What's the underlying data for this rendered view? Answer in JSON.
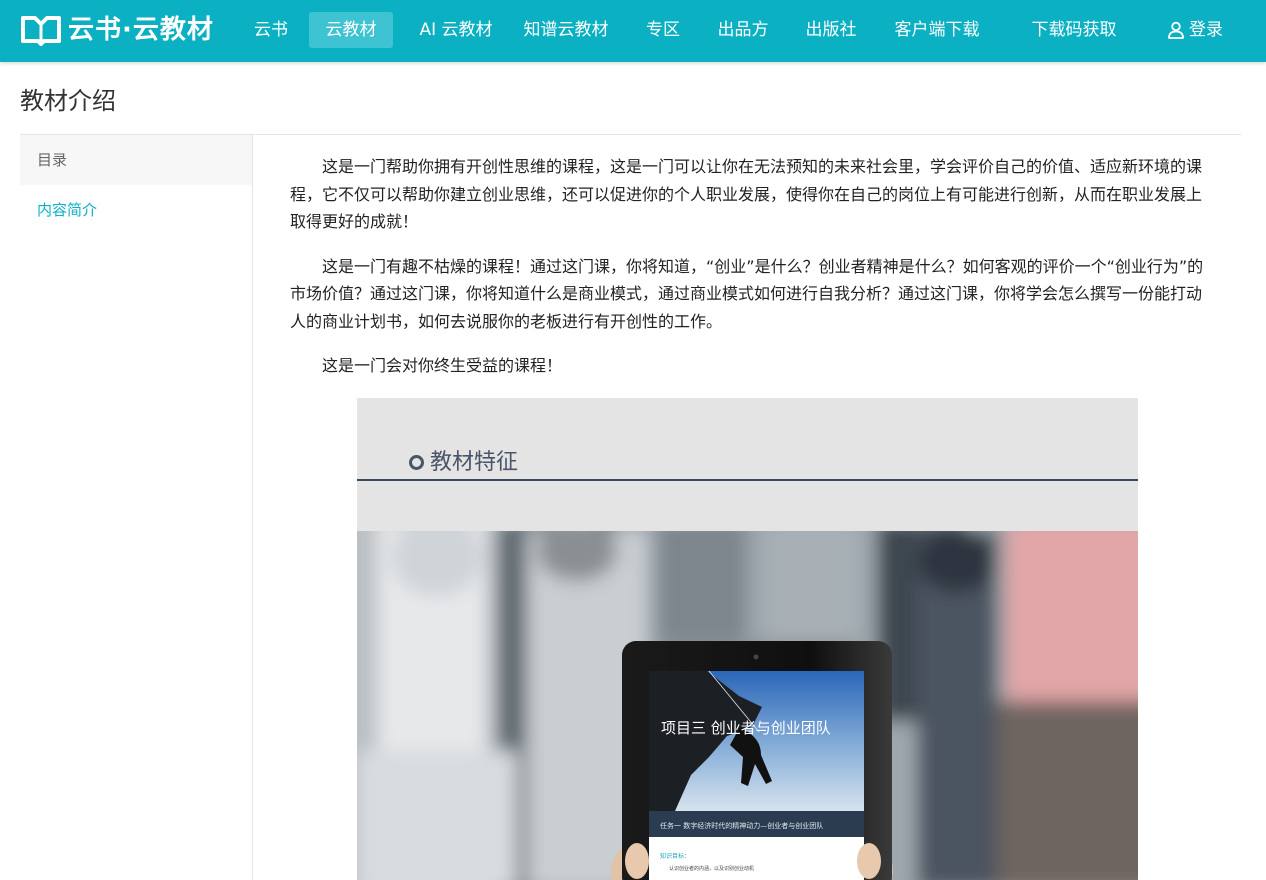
{
  "header": {
    "brand": "云书·云教材",
    "nav": [
      {
        "label": "云书",
        "active": false
      },
      {
        "label": "云教材",
        "active": true
      },
      {
        "label": "AI 云教材",
        "active": false
      },
      {
        "label": "知谱云教材",
        "active": false
      },
      {
        "label": "专区",
        "active": false
      },
      {
        "label": "出品方",
        "active": false
      },
      {
        "label": "出版社",
        "active": false
      },
      {
        "label": "客户端下载",
        "active": false
      },
      {
        "label": "下载码获取",
        "active": false
      }
    ],
    "login_label": "登录",
    "icons": {
      "logo": "book-logo-icon",
      "login": "user-icon"
    },
    "colors": {
      "brand": "#0bb1c3",
      "active_nav": "#3dc3d1"
    }
  },
  "page": {
    "title": "教材介绍"
  },
  "sidebar": {
    "header": "目录",
    "items": [
      {
        "label": "内容简介"
      }
    ]
  },
  "intro": {
    "paragraphs": [
      "这是一门帮助你拥有开创性思维的课程，这是一门可以让你在无法预知的未来社会里，学会评价自己的价值、适应新环境的课程，它不仅可以帮助你建立创业思维，还可以促进你的个人职业发展，使得你在自己的岗位上有可能进行创新，从而在职业发展上取得更好的成就！",
      "这是一门有趣不枯燥的课程！通过这门课，你将知道，“创业”是什么？创业者精神是什么？如何客观的评价一个“创业行为”的市场价值？通过这门课，你将知道什么是商业模式，通过商业模式如何进行自我分析？通过这门课，你将学会怎么撰写一份能打动人的商业计划书，如何去说服你的老板进行有开创性的工作。",
      "这是一门会对你终生受益的课程！"
    ]
  },
  "figure": {
    "section_title": "教材特征",
    "tablet_title": "项目三 创业者与创业团队",
    "tablet_task": "任务一 数字经济时代的精神动力—创业者与创业团队",
    "tablet_goal_heading": "知识目标：",
    "tablet_goal_item": "认识创业者的内涵，以及识别创业动机"
  }
}
